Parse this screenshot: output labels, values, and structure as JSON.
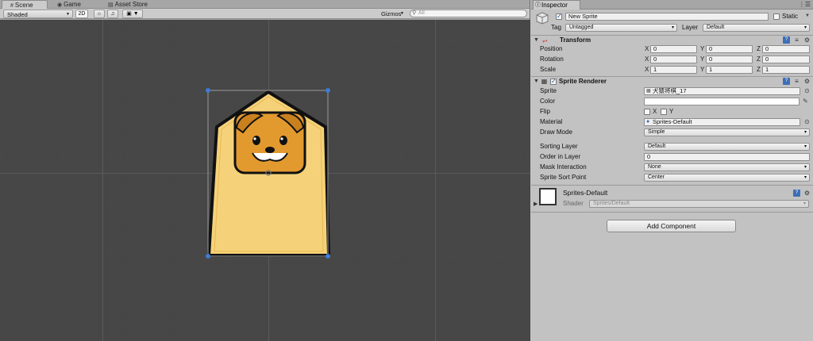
{
  "scene": {
    "tabs": [
      {
        "label": "Scene",
        "icon": "scene-icon"
      },
      {
        "label": "Game",
        "icon": "game-icon"
      },
      {
        "label": "Asset Store",
        "icon": "store-icon"
      }
    ],
    "toolbar": {
      "shading_mode": "Shaded",
      "mode_2d": "2D",
      "gizmos_label": "Gizmos",
      "search_placeholder": "All"
    }
  },
  "inspector": {
    "tab_label": "Inspector",
    "object": {
      "name": "New Sprite",
      "static_label": "Static",
      "tag_label": "Tag",
      "tag_value": "Untagged",
      "layer_label": "Layer",
      "layer_value": "Default"
    },
    "transform": {
      "title": "Transform",
      "position": {
        "label": "Position",
        "x": "0",
        "y": "0",
        "z": "0"
      },
      "rotation": {
        "label": "Rotation",
        "x": "0",
        "y": "0",
        "z": "0"
      },
      "scale": {
        "label": "Scale",
        "x": "1",
        "y": "1",
        "z": "1"
      },
      "axis_labels": {
        "x": "X",
        "y": "Y",
        "z": "Z"
      }
    },
    "sprite_renderer": {
      "title": "Sprite Renderer",
      "sprite_label": "Sprite",
      "sprite_value": "犬猿将棋_17",
      "color_label": "Color",
      "flip_label": "Flip",
      "flip_x": "X",
      "flip_y": "Y",
      "material_label": "Material",
      "material_value": "Sprites-Default",
      "draw_mode_label": "Draw Mode",
      "draw_mode_value": "Simple",
      "sorting_layer_label": "Sorting Layer",
      "sorting_layer_value": "Default",
      "order_label": "Order in Layer",
      "order_value": "0",
      "mask_label": "Mask Interaction",
      "mask_value": "None",
      "sort_point_label": "Sprite Sort Point",
      "sort_point_value": "Center"
    },
    "material": {
      "name": "Sprites-Default",
      "shader_label": "Shader",
      "shader_value": "Sprites/Default"
    },
    "add_component_label": "Add Component"
  },
  "colors": {
    "viewport_bg": "#474747",
    "sprite_fill": "#f5d27a",
    "sprite_outline": "#111111",
    "dog_face": "#e29a2f",
    "selection_handle": "#3d7bd6"
  }
}
